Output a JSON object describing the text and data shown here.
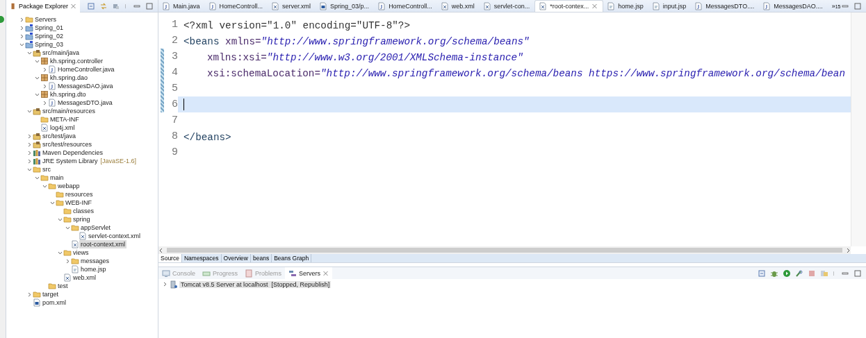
{
  "package_explorer": {
    "title": "Package Explorer",
    "tree": [
      {
        "label": "Servers",
        "kind": "folder",
        "expanded": false,
        "selected": false
      },
      {
        "label": "Spring_01",
        "kind": "project",
        "expanded": false,
        "selected": false
      },
      {
        "label": "Spring_02",
        "kind": "project",
        "expanded": false,
        "selected": false
      },
      {
        "label": "Spring_03",
        "kind": "project",
        "expanded": true,
        "selected": false,
        "children": [
          {
            "label": "src/main/java",
            "kind": "source-folder",
            "expanded": true,
            "selected": false,
            "children": [
              {
                "label": "kh.spring.controller",
                "kind": "package",
                "expanded": true,
                "selected": false,
                "children": [
                  {
                    "label": "HomeController.java",
                    "kind": "java-file",
                    "expanded": false,
                    "selected": false
                  }
                ]
              },
              {
                "label": "kh.spring.dao",
                "kind": "package",
                "expanded": true,
                "selected": false,
                "children": [
                  {
                    "label": "MessagesDAO.java",
                    "kind": "java-file",
                    "expanded": false,
                    "selected": false
                  }
                ]
              },
              {
                "label": "kh.spring.dto",
                "kind": "package",
                "expanded": true,
                "selected": false,
                "children": [
                  {
                    "label": "MessagesDTO.java",
                    "kind": "java-file",
                    "expanded": false,
                    "selected": false
                  }
                ]
              }
            ]
          },
          {
            "label": "src/main/resources",
            "kind": "source-folder",
            "expanded": true,
            "selected": false,
            "children": [
              {
                "label": "META-INF",
                "kind": "folder",
                "selected": false
              },
              {
                "label": "log4j.xml",
                "kind": "xml-file",
                "selected": false
              }
            ]
          },
          {
            "label": "src/test/java",
            "kind": "source-folder",
            "expanded": false,
            "selected": false
          },
          {
            "label": "src/test/resources",
            "kind": "source-folder",
            "expanded": false,
            "selected": false
          },
          {
            "label": "Maven Dependencies",
            "kind": "library",
            "expanded": false,
            "selected": false
          },
          {
            "label": "JRE System Library",
            "decoration": "[JavaSE-1.6]",
            "kind": "library",
            "expanded": false,
            "selected": false
          },
          {
            "label": "src",
            "kind": "folder",
            "expanded": true,
            "selected": false,
            "children": [
              {
                "label": "main",
                "kind": "folder",
                "expanded": true,
                "selected": false,
                "children": [
                  {
                    "label": "webapp",
                    "kind": "folder",
                    "expanded": true,
                    "selected": false,
                    "children": [
                      {
                        "label": "resources",
                        "kind": "folder",
                        "selected": false
                      },
                      {
                        "label": "WEB-INF",
                        "kind": "folder",
                        "expanded": true,
                        "selected": false,
                        "children": [
                          {
                            "label": "classes",
                            "kind": "folder",
                            "selected": false
                          },
                          {
                            "label": "spring",
                            "kind": "folder",
                            "expanded": true,
                            "selected": false,
                            "children": [
                              {
                                "label": "appServlet",
                                "kind": "folder",
                                "expanded": true,
                                "selected": false,
                                "children": [
                                  {
                                    "label": "servlet-context.xml",
                                    "kind": "xml-file",
                                    "selected": false
                                  }
                                ]
                              },
                              {
                                "label": "root-context.xml",
                                "kind": "xml-file",
                                "selected": true
                              }
                            ]
                          },
                          {
                            "label": "views",
                            "kind": "folder",
                            "expanded": true,
                            "selected": false,
                            "children": [
                              {
                                "label": "messages",
                                "kind": "folder",
                                "expanded": false,
                                "selected": false
                              },
                              {
                                "label": "home.jsp",
                                "kind": "jsp-file",
                                "selected": false
                              }
                            ]
                          },
                          {
                            "label": "web.xml",
                            "kind": "xml-file",
                            "selected": false
                          }
                        ]
                      }
                    ]
                  },
                  {
                    "label": "test",
                    "kind": "folder",
                    "selected": false
                  }
                ]
              }
            ]
          },
          {
            "label": "target",
            "kind": "folder",
            "expanded": false,
            "selected": false
          },
          {
            "label": "pom.xml",
            "kind": "maven-file",
            "selected": false
          }
        ]
      }
    ]
  },
  "editor": {
    "tabs": [
      {
        "label": "Main.java",
        "kind": "java-file",
        "selected": false
      },
      {
        "label": "HomeControll...",
        "kind": "java-file",
        "selected": false
      },
      {
        "label": "server.xml",
        "kind": "xml-file",
        "selected": false
      },
      {
        "label": "Spring_03/p...",
        "kind": "maven-file",
        "selected": false
      },
      {
        "label": "HomeControll...",
        "kind": "java-file",
        "selected": false
      },
      {
        "label": "web.xml",
        "kind": "xml-file",
        "selected": false
      },
      {
        "label": "servlet-con...",
        "kind": "xml-file",
        "selected": false
      },
      {
        "label": "*root-contex...",
        "kind": "xml-file",
        "selected": true
      },
      {
        "label": "home.jsp",
        "kind": "jsp-file",
        "selected": false
      },
      {
        "label": "input.jsp",
        "kind": "jsp-file",
        "selected": false
      },
      {
        "label": "MessagesDTO....",
        "kind": "java-file",
        "selected": false
      },
      {
        "label": "MessagesDAO....",
        "kind": "java-file",
        "selected": false
      }
    ],
    "overflow": "»",
    "overflow_count": "15",
    "lines": [
      {
        "number": "1",
        "changed": false,
        "current": false,
        "tokens": [
          {
            "kind": "plain",
            "text": "<?xml version=\"1.0\" encoding=\"UTF-8\"?>"
          }
        ]
      },
      {
        "number": "2",
        "changed": false,
        "current": false,
        "tokens": [
          {
            "kind": "tag",
            "text": "<beans "
          },
          {
            "kind": "attr",
            "text": "xmlns="
          },
          {
            "kind": "value",
            "text": "\"http://www.springframework.org/schema/beans\""
          }
        ]
      },
      {
        "number": "3",
        "changed": true,
        "current": false,
        "indented": true,
        "tokens": [
          {
            "kind": "attr",
            "text": "xmlns:xsi="
          },
          {
            "kind": "value",
            "text": "\"http://www.w3.org/2001/XMLSchema-instance\""
          }
        ]
      },
      {
        "number": "4",
        "changed": true,
        "current": false,
        "indented": true,
        "tokens": [
          {
            "kind": "attr",
            "text": "xsi:schemaLocation="
          },
          {
            "kind": "value",
            "text": "\"http://www.springframework.org/schema/beans https://www.springframework.org/schema/bean"
          }
        ]
      },
      {
        "number": "5",
        "changed": true,
        "current": false
      },
      {
        "number": "6",
        "changed": true,
        "current": true
      },
      {
        "number": "7",
        "changed": false,
        "current": false
      },
      {
        "number": "8",
        "changed": false,
        "current": false,
        "tokens": [
          {
            "kind": "tag",
            "text": "</beans>"
          }
        ]
      },
      {
        "number": "9",
        "changed": false,
        "current": false
      }
    ],
    "sub_tabs": [
      {
        "label": "Source",
        "selected": true
      },
      {
        "label": "Namespaces",
        "selected": false
      },
      {
        "label": "Overview",
        "selected": false
      },
      {
        "label": "beans",
        "selected": false
      },
      {
        "label": "Beans Graph",
        "selected": false
      }
    ]
  },
  "bottom_panel": {
    "tabs": [
      {
        "label": "Console",
        "kind": "console",
        "selected": false
      },
      {
        "label": "Progress",
        "kind": "progress",
        "selected": false
      },
      {
        "label": "Problems",
        "kind": "problems",
        "selected": false
      },
      {
        "label": "Servers",
        "kind": "servers",
        "selected": true
      }
    ],
    "servers": [
      {
        "label": "Tomcat v8.5 Server at localhost",
        "status": "[Stopped, Republish]",
        "expanded": false
      }
    ]
  }
}
